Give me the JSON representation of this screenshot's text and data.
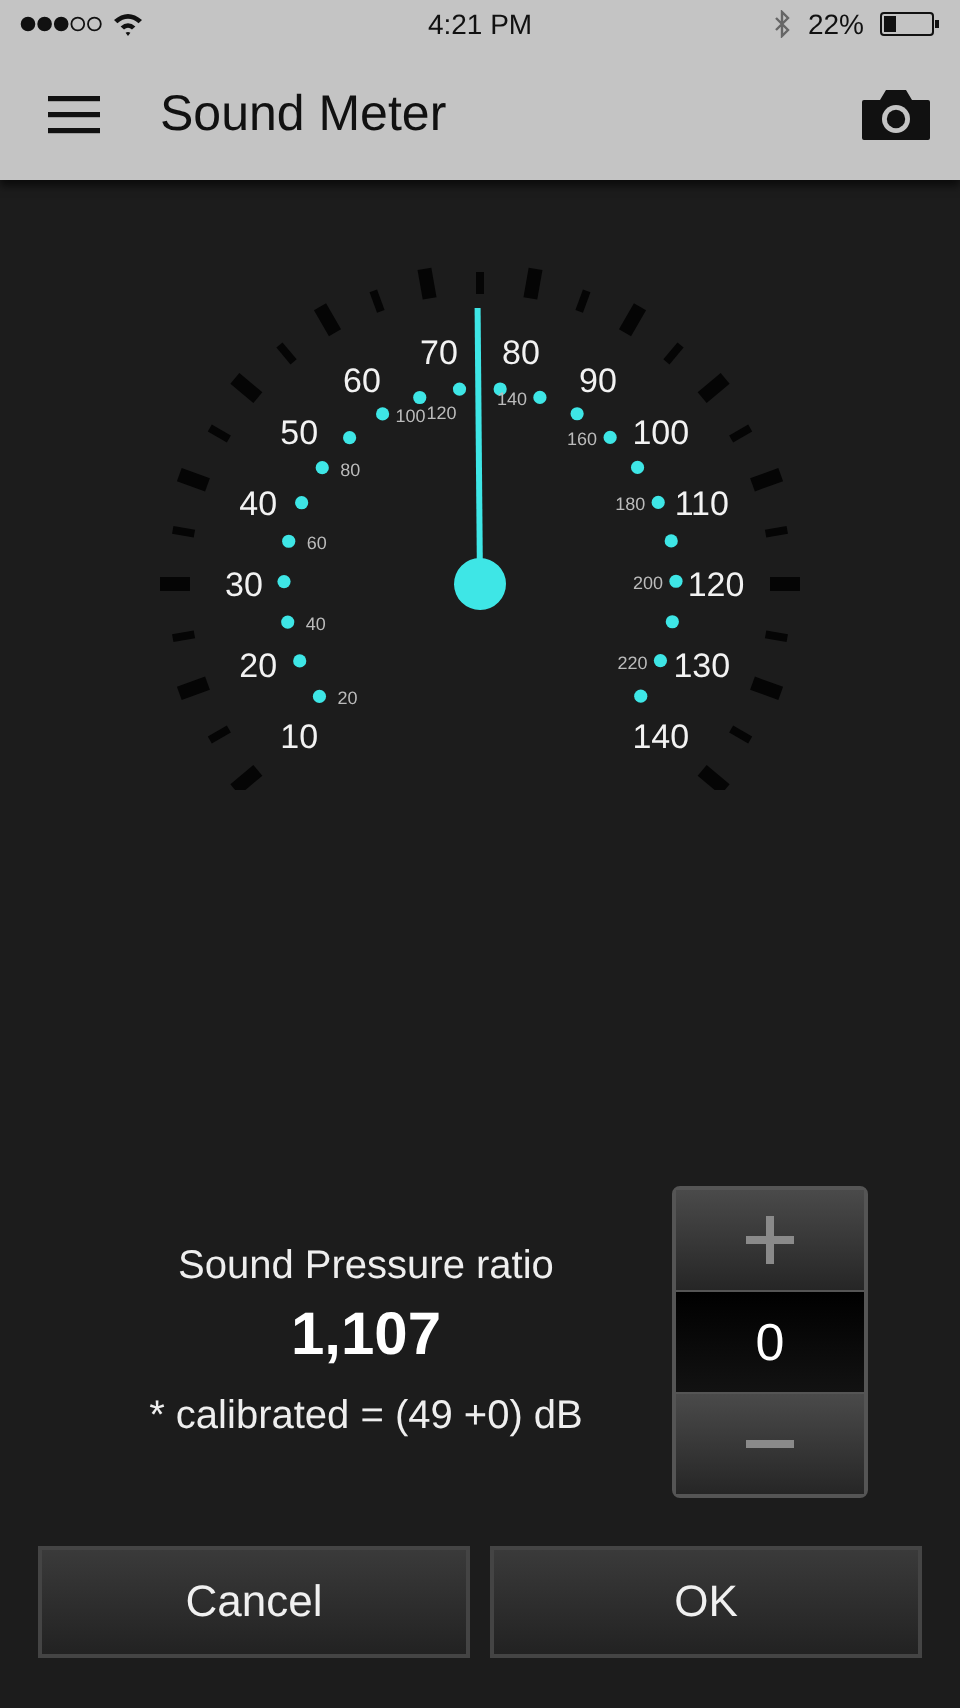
{
  "status_bar": {
    "time": "4:21 PM",
    "battery": "22%"
  },
  "app_bar": {
    "title": "Sound Meter"
  },
  "gauge": {
    "outer_left_labels": [
      "70",
      "60",
      "50",
      "40",
      "30",
      "20",
      "10"
    ],
    "outer_right_labels": [
      "80",
      "90",
      "100",
      "110",
      "120",
      "130",
      "140"
    ],
    "inner_left_labels": [
      "120",
      "100",
      "80",
      "60",
      "40",
      "20"
    ],
    "inner_right_labels": [
      "140",
      "160",
      "180",
      "200",
      "220"
    ]
  },
  "readout": {
    "label": "Sound Pressure ratio",
    "value": "1,107",
    "note": "* calibrated = (49 +0) dB"
  },
  "stepper": {
    "value": "0"
  },
  "buttons": [
    "Cancel",
    "OK"
  ]
}
